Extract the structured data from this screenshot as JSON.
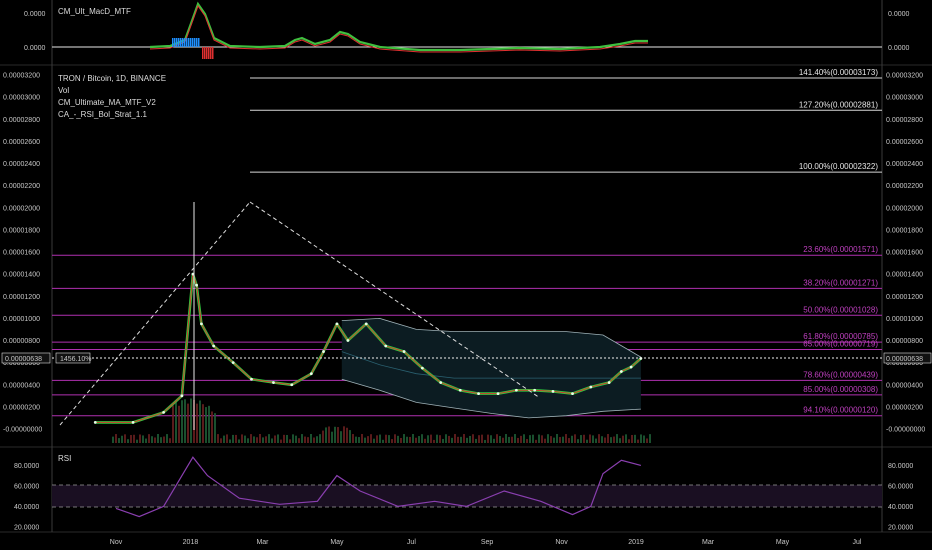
{
  "title": "TRON / Bitcoin, 1D, BINANCE",
  "legend": [
    "Vol",
    "CM_Ultimate_MA_MTF_V2",
    "CA_-_RSI_Bol_Strat_1.1"
  ],
  "colors": {
    "background": "#000000",
    "up": "#2ecc40",
    "down": "#e0302a",
    "fib_white": "#d8d8d8",
    "fib_magenta": "#b030b0",
    "rsi": "#8a3fb0",
    "macd_up": "#3fbf3f",
    "macd_down": "#e03030",
    "macd_hist": "#1e90ff"
  },
  "macd_pane": {
    "label": "CM_Ult_MacD_MTF",
    "y_labels": [
      "0.0000",
      "0.0000"
    ],
    "right_labels": [
      "0.0000",
      "0.0000"
    ]
  },
  "price_axis": {
    "labels": [
      "0.00003200",
      "0.00003000",
      "0.00002800",
      "0.00002600",
      "0.00002400",
      "0.00002200",
      "0.00002000",
      "0.00001800",
      "0.00001600",
      "0.00001400",
      "0.00001200",
      "0.00001000",
      "0.00000800",
      "0.00000600",
      "0.00000400",
      "0.00000200",
      "-0.00000000"
    ],
    "current_price": "0.00000638",
    "current_change": "1456.10%"
  },
  "fib_levels": [
    {
      "label": "141.40%(0.00003173)",
      "value": 3.173e-05,
      "color": "white"
    },
    {
      "label": "127.20%(0.00002881)",
      "value": 2.881e-05,
      "color": "white"
    },
    {
      "label": "100.00%(0.00002322)",
      "value": 2.322e-05,
      "color": "white"
    },
    {
      "label": "23.60%(0.00001571)",
      "value": 1.571e-05,
      "color": "magenta"
    },
    {
      "label": "38.20%(0.00001271)",
      "value": 1.271e-05,
      "color": "magenta"
    },
    {
      "label": "50.00%(0.00001028)",
      "value": 1.028e-05,
      "color": "magenta"
    },
    {
      "label": "61.80%(0.00000785)",
      "value": 7.85e-06,
      "color": "magenta"
    },
    {
      "label": "65.00%(0.00000719)",
      "value": 7.19e-06,
      "color": "magenta"
    },
    {
      "label": "78.60%(0.00000439)",
      "value": 4.39e-06,
      "color": "magenta"
    },
    {
      "label": "85.00%(0.00000308)",
      "value": 3.08e-06,
      "color": "magenta"
    },
    {
      "label": "94.10%(0.00000120)",
      "value": 1.2e-06,
      "color": "magenta"
    }
  ],
  "rsi_pane": {
    "label": "RSI",
    "labels": [
      "80.0000",
      "60.0000",
      "40.0000",
      "20.0000"
    ]
  },
  "x_axis": {
    "labels": [
      "Nov",
      "2018",
      "Mar",
      "May",
      "Jul",
      "Sep",
      "Nov",
      "2019",
      "Mar",
      "May",
      "Jul"
    ]
  },
  "chart_data": {
    "type": "line",
    "title": "TRON / Bitcoin, 1D, BINANCE",
    "ylim": [
      -3e-07,
      3.2e-06
    ],
    "y_scale": "linear",
    "x": [
      "2017-10-15",
      "2017-11-15",
      "2017-12-10",
      "2017-12-25",
      "2018-01-03",
      "2018-01-06",
      "2018-01-10",
      "2018-01-20",
      "2018-02-05",
      "2018-02-20",
      "2018-03-10",
      "2018-03-25",
      "2018-04-10",
      "2018-04-20",
      "2018-05-01",
      "2018-05-10",
      "2018-05-25",
      "2018-06-10",
      "2018-06-25",
      "2018-07-10",
      "2018-07-25",
      "2018-08-10",
      "2018-08-25",
      "2018-09-10",
      "2018-09-25",
      "2018-10-10",
      "2018-10-25",
      "2018-11-10",
      "2018-11-25",
      "2018-12-10",
      "2018-12-20",
      "2018-12-28",
      "2019-01-05"
    ],
    "series": [
      {
        "values": [
          6e-07,
          6e-07,
          1.5e-06,
          3e-06,
          1.4e-05,
          1.3e-05,
          9.5e-06,
          7.5e-06,
          6e-06,
          4.5e-06,
          4.2e-06,
          4e-06,
          5e-06,
          7e-06,
          9.5e-06,
          8e-06,
          9.5e-06,
          7.5e-06,
          7e-06,
          5.5e-06,
          4.2e-06,
          3.5e-06,
          3.2e-06,
          3.2e-06,
          3.5e-06,
          3.5e-06,
          3.4e-06,
          3.2e-06,
          3.8e-06,
          4.2e-06,
          5.2e-06,
          5.6e-06,
          6.38e-06
        ]
      }
    ],
    "macd_note": "",
    "rsi": {
      "x": [
        "2017-11-01",
        "2017-11-20",
        "2017-12-10",
        "2018-01-03",
        "2018-01-15",
        "2018-02-10",
        "2018-03-15",
        "2018-04-15",
        "2018-05-01",
        "2018-05-20",
        "2018-06-20",
        "2018-07-20",
        "2018-08-15",
        "2018-09-15",
        "2018-10-15",
        "2018-11-10",
        "2018-11-25",
        "2018-12-05",
        "2018-12-20",
        "2019-01-05"
      ],
      "values": [
        38,
        30,
        40,
        88,
        70,
        48,
        42,
        45,
        70,
        55,
        40,
        45,
        40,
        55,
        45,
        32,
        40,
        72,
        85,
        80
      ],
      "levels": [
        60,
        40
      ],
      "ylim": [
        15,
        95
      ]
    }
  }
}
